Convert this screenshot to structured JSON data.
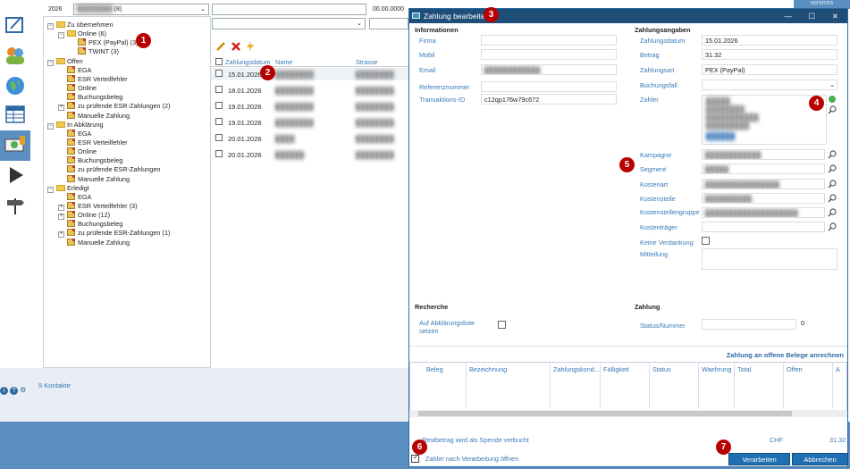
{
  "topbar": {
    "year": "2026",
    "filter_value": "(8)",
    "amount": "00.00.0000",
    "services_label": "services"
  },
  "tree": [
    {
      "label": "Zu übernehmen",
      "level": 0,
      "type": "folder",
      "pm": "−"
    },
    {
      "label": "Online (6)",
      "level": 1,
      "type": "folder",
      "pm": "−"
    },
    {
      "label": "PEX (PayPal) (3)",
      "level": 2,
      "type": "doc"
    },
    {
      "label": "TWINT (3)",
      "level": 2,
      "type": "doc"
    },
    {
      "label": "Offen",
      "level": 0,
      "type": "folder",
      "pm": "−"
    },
    {
      "label": "EGA",
      "level": 1,
      "type": "doc"
    },
    {
      "label": "ESR Verteilfehler",
      "level": 1,
      "type": "doc"
    },
    {
      "label": "Online",
      "level": 1,
      "type": "doc"
    },
    {
      "label": "Buchungsbeleg",
      "level": 1,
      "type": "doc"
    },
    {
      "label": "zu prüfende ESR-Zahlungen (2)",
      "level": 1,
      "type": "doc",
      "pm": "+"
    },
    {
      "label": "Manuelle Zahlung",
      "level": 1,
      "type": "doc"
    },
    {
      "label": "In Abklärung",
      "level": 0,
      "type": "folder",
      "pm": "−"
    },
    {
      "label": "EGA",
      "level": 1,
      "type": "doc"
    },
    {
      "label": "ESR Verteilfehler",
      "level": 1,
      "type": "doc"
    },
    {
      "label": "Online",
      "level": 1,
      "type": "doc"
    },
    {
      "label": "Buchungsbeleg",
      "level": 1,
      "type": "doc"
    },
    {
      "label": "zu prüfende ESR-Zahlungen",
      "level": 1,
      "type": "doc"
    },
    {
      "label": "Manuelle Zahlung",
      "level": 1,
      "type": "doc"
    },
    {
      "label": "Erledigt",
      "level": 0,
      "type": "folder",
      "pm": "−"
    },
    {
      "label": "EGA",
      "level": 1,
      "type": "doc"
    },
    {
      "label": "ESR Verteilfehler (3)",
      "level": 1,
      "type": "doc",
      "pm": "+"
    },
    {
      "label": "Online (12)",
      "level": 1,
      "type": "doc",
      "pm": "+"
    },
    {
      "label": "Buchungsbeleg",
      "level": 1,
      "type": "doc"
    },
    {
      "label": "zu prüfende ESR-Zahlungen (1)",
      "level": 1,
      "type": "doc",
      "pm": "+"
    },
    {
      "label": "Manuelle Zahlung",
      "level": 1,
      "type": "doc"
    }
  ],
  "contacts_count": "5 Kontakte",
  "list": {
    "columns": [
      "Zahlungsdatum",
      "Name",
      "Strasse"
    ],
    "rows": [
      {
        "date": "15.01.2026",
        "name": "████████",
        "street": "████████"
      },
      {
        "date": "18.01.2026",
        "name": "████████",
        "street": "████████"
      },
      {
        "date": "19.01.2026",
        "name": "████████",
        "street": "████████"
      },
      {
        "date": "19.01.2026",
        "name": "████████",
        "street": "████████"
      },
      {
        "date": "20.01.2026",
        "name": "████",
        "street": "████████"
      },
      {
        "date": "20.01.2026",
        "name": "██████",
        "street": "████████"
      }
    ]
  },
  "dialog": {
    "title": "Zahlung bearbeiten",
    "info_section": "Informationen",
    "info_fields": [
      {
        "label": "Firma",
        "value": ""
      },
      {
        "label": "Mobil",
        "value": ""
      },
      {
        "label": "Email",
        "value": "████████████"
      },
      {
        "label": "Referenznummer",
        "value": ""
      },
      {
        "label": "Transaktions-ID",
        "value": "c12qp176w79c672"
      }
    ],
    "payment_section": "Zahlungsangaben",
    "payment_fields": [
      {
        "label": "Zahlungsdatum",
        "value": "15.01.2026"
      },
      {
        "label": "Betrag",
        "value": "31.32"
      },
      {
        "label": "Zahlungsart",
        "value": "PEX (PayPal)"
      },
      {
        "label": "Buchungsfall",
        "value": ""
      }
    ],
    "payer_label": "Zahler",
    "payer_lines": [
      "█████",
      "████████",
      "███████████",
      "█████████",
      "██████"
    ],
    "lookup_fields": [
      {
        "label": "Kampagne",
        "value": "████████████"
      },
      {
        "label": "Segment",
        "value": "█████"
      },
      {
        "label": "Kostenart",
        "value": "████████████████"
      },
      {
        "label": "Kostenstelle",
        "value": "██████████"
      },
      {
        "label": "Kostenstellengruppe",
        "value": "████████████████████"
      },
      {
        "label": "Kostenträger",
        "value": ""
      }
    ],
    "no_donation_label": "Keine Verdankung",
    "comment_label": "Mitteilung",
    "research_section": "Recherche",
    "research_label": "Auf Abklärungsliste setzen",
    "payment2_section": "Zahlung",
    "status_label": "Status/Nummer",
    "status_value": "0",
    "assign_link": "Zahlung an offene Belege anrechnen",
    "grid_columns": [
      "Beleg",
      "Bezeichnung",
      "Zahlungskond...",
      "Fälligkeit",
      "Status",
      "Waehrung",
      "Total",
      "Offen",
      "A"
    ],
    "donation_text": "Restbetrag wird als Spende verbucht",
    "currency": "CHF",
    "total": "31.32",
    "open_after_label": "Zahler nach Verarbeitung öffnen",
    "process_button": "Verarbeiten",
    "cancel_button": "Abbrechen"
  },
  "badges": [
    "1",
    "2",
    "3",
    "4",
    "5",
    "6",
    "7"
  ],
  "colors": {
    "accent": "#1f6fb2",
    "title_bar": "#1f4e79",
    "badge": "#b80000",
    "label": "#3a7ab8"
  }
}
